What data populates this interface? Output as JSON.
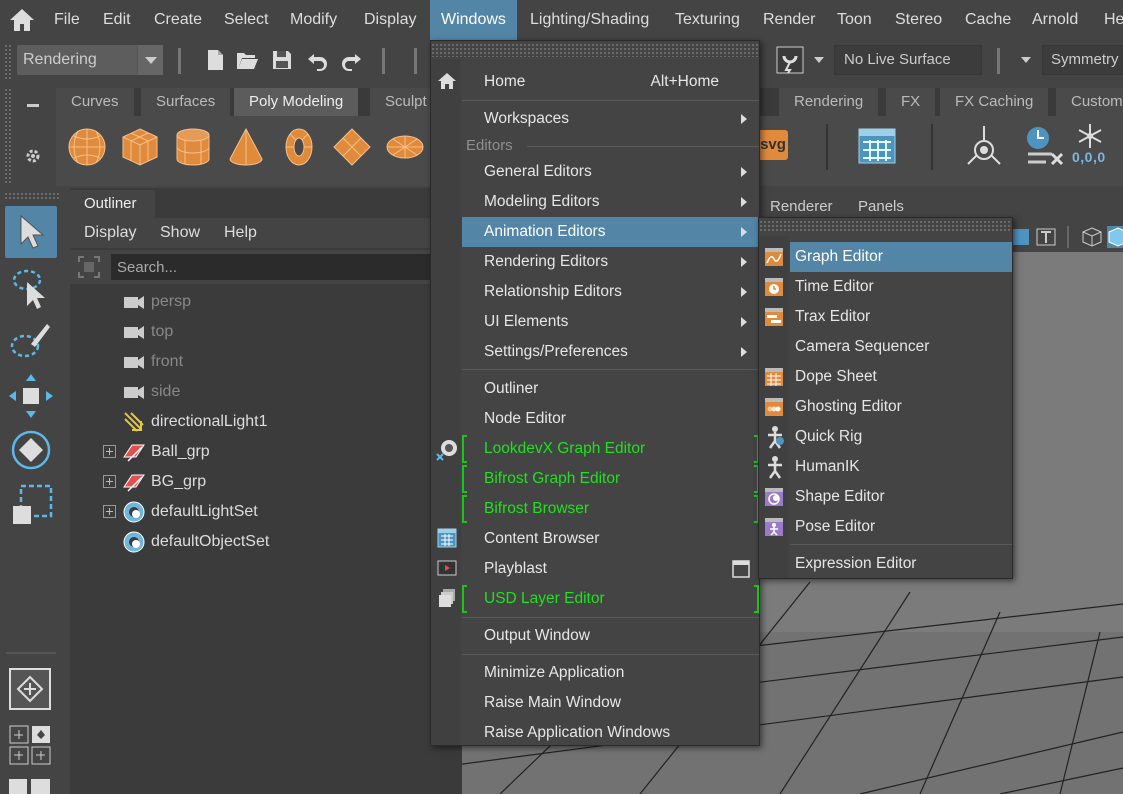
{
  "menubar": {
    "items": [
      "File",
      "Edit",
      "Create",
      "Select",
      "Modify",
      "Display",
      "Windows",
      "Lighting/Shading",
      "Texturing",
      "Render",
      "Toon",
      "Stereo",
      "Cache",
      "Arnold",
      "He"
    ],
    "active": "Windows"
  },
  "statusline": {
    "mode": "Rendering",
    "live_surface": "No Live Surface",
    "symmetry": "Symmetry"
  },
  "shelf": {
    "tabs": [
      "Curves",
      "Surfaces",
      "Poly Modeling",
      "Sculpt",
      "Rendering",
      "FX",
      "FX Caching",
      "Custom"
    ],
    "active_tab": "Poly Modeling",
    "svg_label": "svg",
    "coord_readout": "0,0,0"
  },
  "outliner": {
    "tab": "Outliner",
    "menus": [
      "Display",
      "Show",
      "Help"
    ],
    "search_placeholder": "Search...",
    "rows": [
      {
        "label": "persp",
        "icon": "camera-icon"
      },
      {
        "label": "top",
        "icon": "camera-icon"
      },
      {
        "label": "front",
        "icon": "camera-icon"
      },
      {
        "label": "side",
        "icon": "camera-icon"
      },
      {
        "label": "directionalLight1",
        "icon": "directional-light-icon"
      },
      {
        "label": "Ball_grp",
        "icon": "group-icon"
      },
      {
        "label": "BG_grp",
        "icon": "group-icon"
      },
      {
        "label": "defaultLightSet",
        "icon": "set-icon"
      },
      {
        "label": "defaultObjectSet",
        "icon": "set-icon"
      }
    ]
  },
  "panel_menus": [
    "Renderer",
    "Panels"
  ],
  "windows_menu": {
    "home": "Home",
    "home_shortcut": "Alt+Home",
    "workspaces": "Workspaces",
    "editors_header": "Editors",
    "general_editors": "General Editors",
    "modeling_editors": "Modeling Editors",
    "animation_editors": "Animation Editors",
    "rendering_editors": "Rendering Editors",
    "relationship_editors": "Relationship Editors",
    "ui_elements": "UI Elements",
    "settings_preferences": "Settings/Preferences",
    "outliner": "Outliner",
    "node_editor": "Node Editor",
    "lookdevx": "LookdevX Graph Editor",
    "bifrost_graph": "Bifrost Graph Editor",
    "bifrost_browser": "Bifrost Browser",
    "content_browser": "Content Browser",
    "playblast": "Playblast",
    "usd_layer": "USD Layer Editor",
    "output_window": "Output Window",
    "minimize": "Minimize Application",
    "raise_main": "Raise Main Window",
    "raise_app": "Raise Application Windows"
  },
  "animation_menu": {
    "items": [
      "Graph Editor",
      "Time Editor",
      "Trax Editor",
      "Camera Sequencer",
      "Dope Sheet",
      "Ghosting Editor",
      "Quick Rig",
      "HumanIK",
      "Shape Editor",
      "Pose Editor"
    ],
    "expression_editor": "Expression Editor"
  },
  "colors": {
    "highlight": "#5285a6",
    "plugin_text": "#1fe11f",
    "menu_bg": "#444444",
    "shelf_icon": "#e08a3c"
  }
}
